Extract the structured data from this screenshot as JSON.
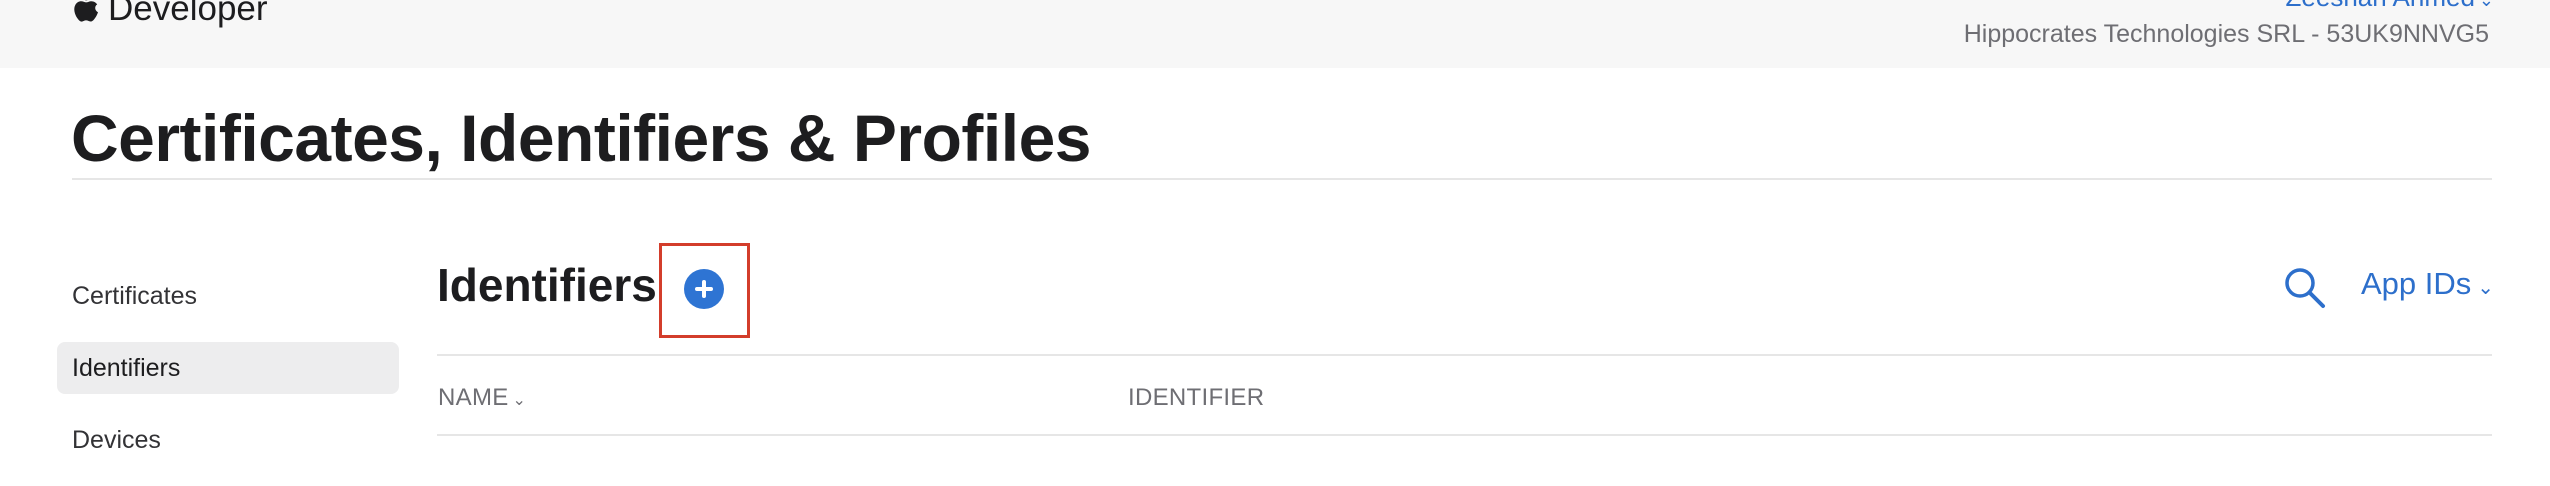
{
  "header": {
    "brand_label": "Developer",
    "brand_icon": "apple-logo-icon",
    "user_name": "Zeeshan Ahmed",
    "user_chevron": "⌄",
    "team_name": "Hippocrates Technologies SRL - 53UK9NNVG5"
  },
  "page": {
    "title": "Certificates, Identifiers & Profiles"
  },
  "sidebar": {
    "items": [
      {
        "label": "Certificates",
        "active": false
      },
      {
        "label": "Identifiers",
        "active": true
      },
      {
        "label": "Devices",
        "active": false
      }
    ]
  },
  "main": {
    "section_title": "Identifiers",
    "add_icon": "plus-circle-icon",
    "search_icon": "search-icon",
    "filter": {
      "value": "App IDs",
      "chevron": "⌄"
    },
    "table": {
      "columns": [
        {
          "label": "NAME",
          "sort_chevron": "⌄"
        },
        {
          "label": "IDENTIFIER"
        }
      ]
    }
  },
  "colors": {
    "accent": "#2d6fcb",
    "add_button": "#2e74d3",
    "highlight": "#d33d2b",
    "topbar": "#f7f7f7"
  }
}
